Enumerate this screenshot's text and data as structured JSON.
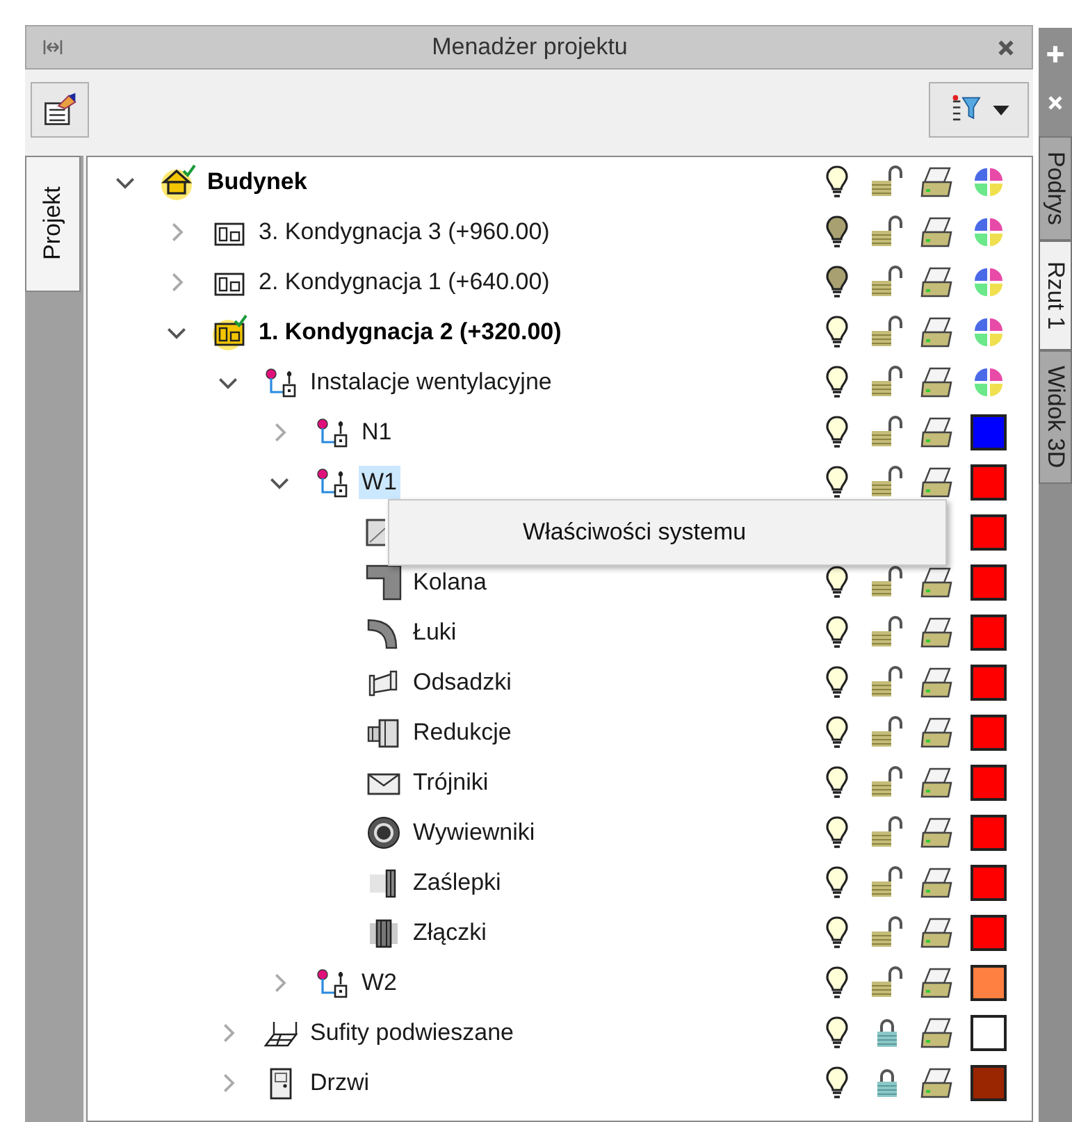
{
  "panel": {
    "title": "Menadżer projektu"
  },
  "left_tabs": [
    {
      "label": "Projekt",
      "selected": true
    }
  ],
  "right_tabs": [
    {
      "label": "Podrys",
      "selected": false
    },
    {
      "label": "Rzut 1",
      "selected": true
    },
    {
      "label": "Widok 3D",
      "selected": false
    }
  ],
  "tree": [
    {
      "label": "Budynek",
      "kind": "building",
      "expanded": true,
      "active": true,
      "selected": false,
      "light_on": true,
      "locked": false,
      "children": [
        {
          "label": "3. Kondygnacja 3 (+960.00)",
          "kind": "storey",
          "expanded": false,
          "active": false,
          "selected": false,
          "light_on": false,
          "locked": false
        },
        {
          "label": "2. Kondygnacja 1 (+640.00)",
          "kind": "storey",
          "expanded": false,
          "active": false,
          "selected": false,
          "light_on": false,
          "locked": false
        },
        {
          "label": "1. Kondygnacja 2 (+320.00)",
          "kind": "storey",
          "expanded": true,
          "active": true,
          "selected": false,
          "light_on": true,
          "locked": false,
          "children": [
            {
              "label": "Instalacje wentylacyjne",
              "kind": "system",
              "expanded": true,
              "active": false,
              "selected": false,
              "light_on": true,
              "locked": false,
              "children": [
                {
                  "label": "N1",
                  "kind": "system",
                  "expanded": false,
                  "active": false,
                  "selected": false,
                  "light_on": true,
                  "locked": false,
                  "color": "#0000ff"
                },
                {
                  "label": "W1",
                  "kind": "system",
                  "expanded": true,
                  "active": false,
                  "selected": true,
                  "light_on": true,
                  "locked": false,
                  "color": "#ff0000",
                  "children": [
                    {
                      "kind": "duct",
                      "color": "#ff0000"
                    },
                    {
                      "label": "Kolana",
                      "kind": "elbow",
                      "active": false,
                      "selected": false,
                      "light_on": true,
                      "locked": false,
                      "color": "#ff0000"
                    },
                    {
                      "label": "Łuki",
                      "kind": "bend",
                      "active": false,
                      "selected": false,
                      "light_on": true,
                      "locked": false,
                      "color": "#ff0000"
                    },
                    {
                      "label": "Odsadzki",
                      "kind": "offset",
                      "active": false,
                      "selected": false,
                      "light_on": true,
                      "locked": false,
                      "color": "#ff0000"
                    },
                    {
                      "label": "Redukcje",
                      "kind": "reducer",
                      "active": false,
                      "selected": false,
                      "light_on": true,
                      "locked": false,
                      "color": "#ff0000"
                    },
                    {
                      "label": "Trójniki",
                      "kind": "tee",
                      "active": false,
                      "selected": false,
                      "light_on": true,
                      "locked": false,
                      "color": "#ff0000"
                    },
                    {
                      "label": "Wywiewniki",
                      "kind": "outlet",
                      "active": false,
                      "selected": false,
                      "light_on": true,
                      "locked": false,
                      "color": "#ff0000"
                    },
                    {
                      "label": "Zaślepki",
                      "kind": "cap",
                      "active": false,
                      "selected": false,
                      "light_on": true,
                      "locked": false,
                      "color": "#ff0000"
                    },
                    {
                      "label": "Złączki",
                      "kind": "coupling",
                      "active": false,
                      "selected": false,
                      "light_on": true,
                      "locked": false,
                      "color": "#ff0000"
                    }
                  ]
                },
                {
                  "label": "W2",
                  "kind": "system",
                  "expanded": false,
                  "active": false,
                  "selected": false,
                  "light_on": true,
                  "locked": false,
                  "color": "#ff8040"
                }
              ]
            },
            {
              "label": "Sufity podwieszane",
              "kind": "ceiling",
              "expanded": false,
              "active": false,
              "selected": false,
              "light_on": true,
              "locked": true,
              "color": "#ffffff"
            },
            {
              "label": "Drzwi",
              "kind": "door",
              "expanded": false,
              "active": false,
              "selected": false,
              "light_on": true,
              "locked": true,
              "color": "#992600"
            }
          ]
        }
      ]
    }
  ],
  "context_menu": {
    "items": [
      "Właściwości systemu"
    ]
  }
}
